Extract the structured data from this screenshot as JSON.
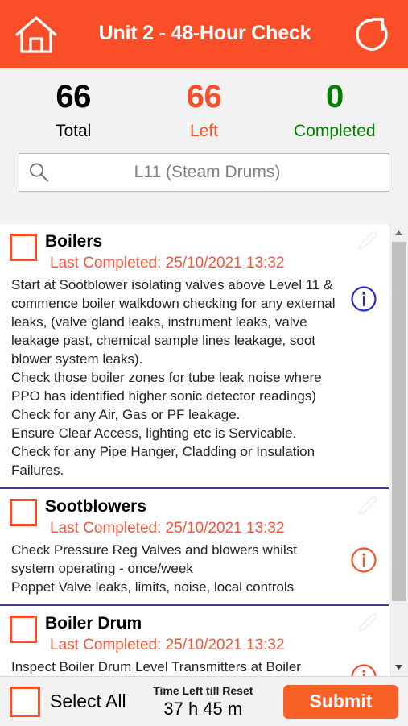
{
  "header": {
    "title": "Unit 2 - 48-Hour Check",
    "home_icon": "home-icon",
    "refresh_icon": "refresh-icon",
    "background": "#f94e27"
  },
  "stats": {
    "total": {
      "value": "66",
      "label": "Total",
      "color": "#000000"
    },
    "left": {
      "value": "66",
      "label": "Left",
      "color": "#f94e27"
    },
    "completed": {
      "value": "0",
      "label": "Completed",
      "color": "#008000"
    }
  },
  "search": {
    "icon": "search-icon",
    "value": "",
    "placeholder": "L11 (Steam Drums)"
  },
  "tasks": [
    {
      "title": "Boilers",
      "last_completed": "Last Completed: 25/10/2021 13:32",
      "body": "Start at Sootblower isolating valves above Level 11 & commence boiler walkdown checking for any external leaks, (valve gland leaks, instrument leaks, valve leakage past, chemical sample lines leakage, soot blower system leaks).\nCheck those boiler zones for tube leak noise where PPO has identified higher sonic detector readings)\nCheck for any Air, Gas or PF leakage.\nEnsure Clear Access, lighting etc is Servicable.\nCheck for any Pipe Hanger, Cladding or Insulation Failures.",
      "info_color": "#2727c8",
      "checked": false
    },
    {
      "title": "Sootblowers",
      "last_completed": "Last Completed: 25/10/2021 13:32",
      "body": "Check Pressure Reg Valves and blowers whilst system operating - once/week\nPoppet Valve leaks, limits, noise, local controls",
      "info_color": "#f94e27",
      "checked": false
    },
    {
      "title": "Boiler Drum",
      "last_completed": "Last Completed: 25/10/2021 13:32",
      "body": "Inspect Boiler Drum Level Transmitters at Boiler",
      "info_color": "#f94e27",
      "checked": false
    }
  ],
  "bottom": {
    "select_all_label": "Select All",
    "timer_label": "Time Left till Reset",
    "timer_value": "37 h 45 m",
    "submit_label": "Submit",
    "submit_color": "#f96127"
  },
  "scrollbar": {
    "up_arrow": "chevron-up-icon",
    "down_arrow": "chevron-down-icon"
  }
}
